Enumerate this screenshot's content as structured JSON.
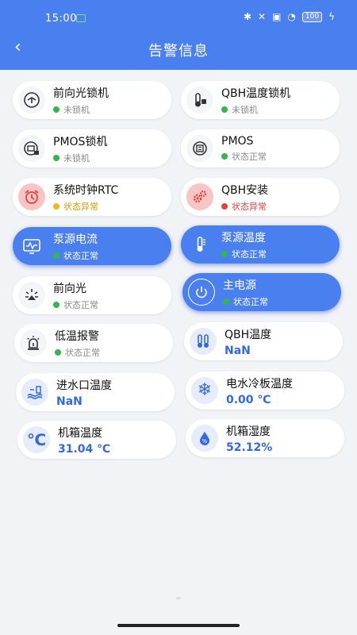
{
  "status_bar": {
    "time": "15:00",
    "battery": "100"
  },
  "header": {
    "title": "告警信息"
  },
  "colors": {
    "ok": "#33b64a",
    "warn": "#f2b620",
    "error": "#e3433a",
    "accent": "#4a7ff0"
  },
  "cards": [
    {
      "label": "前向光锁机",
      "status": "未锁机",
      "icon": "light-lock-icon"
    },
    {
      "label": "QBH温度锁机",
      "status": "未锁机",
      "icon": "thermometer-lock-icon"
    },
    {
      "label": "PMOS锁机",
      "status": "未锁机",
      "icon": "pmos-lock-icon"
    },
    {
      "label": "PMOS",
      "status": "状态正常",
      "icon": "pmos-icon"
    },
    {
      "label": "系统时钟RTC",
      "status": "状态异常",
      "icon": "alarm-clock-icon"
    },
    {
      "label": "QBH安装",
      "status": "状态异常",
      "icon": "gears-icon"
    },
    {
      "label": "泵源电流",
      "status": "状态正常",
      "icon": "monitor-wave-icon"
    },
    {
      "label": "泵源温度",
      "status": "状态正常",
      "icon": "thermometer-icon"
    },
    {
      "label": "前向光",
      "status": "状态正常",
      "icon": "light-icon"
    },
    {
      "label": "主电源",
      "status": "状态正常",
      "icon": "power-icon"
    },
    {
      "label": "低温报警",
      "status": "状态正常",
      "icon": "alarm-light-icon"
    },
    {
      "label": "QBH温度",
      "value": "NaN",
      "icon": "dual-thermometer-icon"
    },
    {
      "label": "进水口温度",
      "value": "NaN",
      "icon": "water-inlet-icon"
    },
    {
      "label": "电水冷板温度",
      "value": "0.00 ℃",
      "icon": "snowflake-icon"
    },
    {
      "label": "机箱温度",
      "value": "31.04 ℃",
      "icon": "celsius-icon"
    },
    {
      "label": "机箱湿度",
      "value": "52.12%",
      "icon": "humidity-drop-icon"
    }
  ]
}
